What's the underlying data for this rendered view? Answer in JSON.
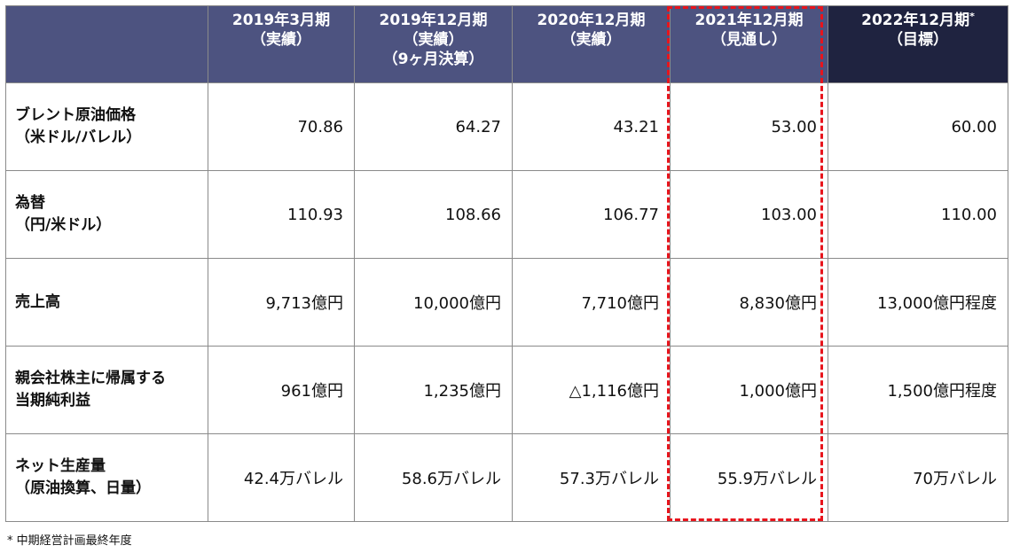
{
  "table": {
    "headers": [
      {
        "line1": "",
        "line2": "",
        "line3": "",
        "sup": ""
      },
      {
        "line1": "2019年3月期",
        "line2": "（実績）",
        "line3": "",
        "sup": ""
      },
      {
        "line1": "2019年12月期",
        "line2": "（実績）",
        "line3": "（9ヶ月決算）",
        "sup": ""
      },
      {
        "line1": "2020年12月期",
        "line2": "（実績）",
        "line3": "",
        "sup": ""
      },
      {
        "line1": "2021年12月期",
        "line2": "（見通し）",
        "line3": "",
        "sup": ""
      },
      {
        "line1": "2022年12月期",
        "line2": "（目標）",
        "line3": "",
        "sup": "*"
      }
    ],
    "rows": [
      {
        "label_line1": "ブレント原油価格",
        "label_line2": "（米ドル/バレル）",
        "values": [
          "70.86",
          "64.27",
          "43.21",
          "53.00",
          "60.00"
        ]
      },
      {
        "label_line1": "為替",
        "label_line2": "（円/米ドル）",
        "values": [
          "110.93",
          "108.66",
          "106.77",
          "103.00",
          "110.00"
        ]
      },
      {
        "label_line1": "売上高",
        "label_line2": "",
        "values": [
          "9,713億円",
          "10,000億円",
          "7,710億円",
          "8,830億円",
          "13,000億円程度"
        ]
      },
      {
        "label_line1": "親会社株主に帰属する",
        "label_line2": "当期純利益",
        "values": [
          "961億円",
          "1,235億円",
          "△1,116億円",
          "1,000億円",
          "1,500億円程度"
        ]
      },
      {
        "label_line1": "ネット生産量",
        "label_line2": "（原油換算、日量）",
        "values": [
          "42.4万バレル",
          "58.6万バレル",
          "57.3万バレル",
          "55.9万バレル",
          "70万バレル"
        ]
      }
    ]
  },
  "highlight_color": "#e8141c",
  "header_color": "#4d5380",
  "target_header_color": "#1f2340",
  "footnote": "* 中期経営計画最終年度"
}
